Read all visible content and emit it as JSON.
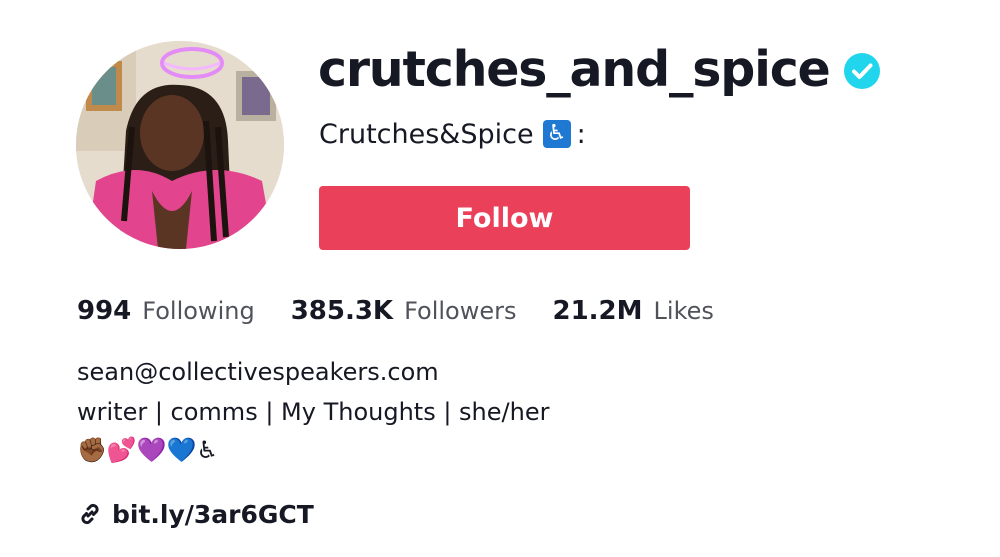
{
  "profile": {
    "username": "crutches_and_spice",
    "verified_icon": "verified-check-icon",
    "display_name": "Crutches&Spice",
    "display_name_badge": "♿",
    "display_name_suffix": ":",
    "avatar_icon": "profile-photo",
    "follow_label": "Follow"
  },
  "stats": [
    {
      "value": "994",
      "label": "Following"
    },
    {
      "value": "385.3K",
      "label": "Followers"
    },
    {
      "value": "21.2M",
      "label": "Likes"
    }
  ],
  "bio": {
    "email": "sean@collectivespeakers.com",
    "tagline": "writer | comms | My Thoughts | she/her",
    "emoji": "✊🏾💕💜💙♿"
  },
  "link": {
    "icon": "link-icon",
    "text": "bit.ly/3ar6GCT"
  },
  "colors": {
    "follow_button": "#ea405a",
    "verified": "#20d5ec",
    "text_primary": "#161823"
  }
}
